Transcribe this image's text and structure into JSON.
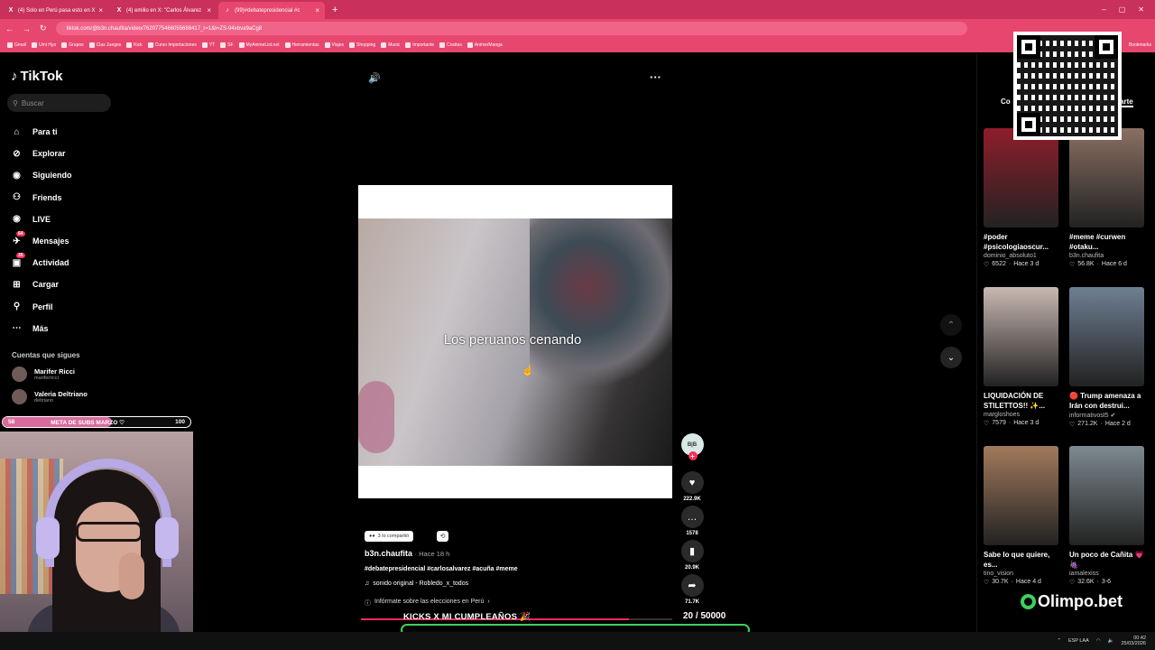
{
  "browser": {
    "tabs": [
      {
        "icon": "X",
        "title": "(4) Solo en Perú pasa esto en X"
      },
      {
        "icon": "X",
        "title": "(4) emilio en X: \"Carlos Álvarez"
      },
      {
        "icon": "♪",
        "title": "(99)#debatepresidencial #c"
      }
    ],
    "url": "tiktok.com/@b3n.chaufita/video/7620775466055688417_r=1&t=ZS-94xbva9aCg8",
    "bookmarks": [
      "Gmail",
      "Umi Hyo",
      "Grupos",
      "Clas Juegos",
      "Kick",
      "Curso Importaciones",
      "YT",
      "SF",
      "MyAnimeList.net",
      "Herramientas",
      "Viajes",
      "Shopping",
      "Music",
      "Importante",
      "Cositas",
      "Anime/Manga"
    ],
    "bookmarks_right": "Bookmarks"
  },
  "sidebar": {
    "logo": "TikTok",
    "search_placeholder": "Buscar",
    "nav": [
      {
        "label": "Para ti",
        "icon": "home-icon",
        "glyph": "⌂"
      },
      {
        "label": "Explorar",
        "icon": "compass-icon",
        "glyph": "⊘"
      },
      {
        "label": "Siguiendo",
        "icon": "following-icon",
        "glyph": "◉"
      },
      {
        "label": "Friends",
        "icon": "friends-icon",
        "glyph": "⚇"
      },
      {
        "label": "LIVE",
        "icon": "live-icon",
        "glyph": "◉"
      },
      {
        "label": "Mensajes",
        "icon": "messages-icon",
        "glyph": "✈",
        "badge": "64"
      },
      {
        "label": "Actividad",
        "icon": "activity-icon",
        "glyph": "▣",
        "badge": "35"
      },
      {
        "label": "Cargar",
        "icon": "upload-icon",
        "glyph": "⊞"
      },
      {
        "label": "Perfil",
        "icon": "profile-icon",
        "glyph": "⚲"
      },
      {
        "label": "Más",
        "icon": "more-icon",
        "glyph": "⋯"
      }
    ],
    "suggested_title": "Cuentas que sigues",
    "suggested": [
      {
        "name": "Marifer Ricci",
        "handle": "mariferricci"
      },
      {
        "name": "Valeria Deltriano",
        "handle": "deltriano"
      }
    ]
  },
  "goal_bar": {
    "left": "58",
    "label": "META DE SUBS MARZO ♡",
    "right": "100",
    "progress": 0.58
  },
  "video": {
    "caption": "Los peruanos cenando",
    "shared_label": "3 lo compartió",
    "author": "b3n.chaufita",
    "time": "· Hace 18 h",
    "tags": "#debatepresidencial #carlosalvarez #acuña #meme",
    "sound": "sonido original - Robledo_x_todos",
    "info": "Infórmate sobre las elecciones en Perú",
    "progress": 0.86
  },
  "actions": {
    "creator_initials": "B|B",
    "likes": "222.9K",
    "comments": "1578",
    "saves": "20.9K",
    "shares": "71.7K"
  },
  "kicks": {
    "title": "KICKS X MI CUMPLEAÑOS 🎉",
    "count": "20",
    "goal": "/ 50000"
  },
  "right_panel": {
    "tab_left": "Co",
    "tab_right": "arte",
    "cards": [
      {
        "title": "#poder #psicologiaoscur...",
        "user": "dominio_absoluto1",
        "views": "6522",
        "age": "Hace 3 d",
        "color": "#8e1e2a"
      },
      {
        "title": "#meme #curwen #otaku...",
        "user": "b3n.chaufita",
        "views": "56.8K",
        "age": "Hace 6 d",
        "color": "#8a6f63"
      },
      {
        "title": "LIQUIDACIÓN DE STILETTOS!! ✨...",
        "user": "margloshoes",
        "views": "7579",
        "age": "Hace 3 d",
        "color": "#c9b9b2"
      },
      {
        "title": "🔴 Trump amenaza a Irán con destrui...",
        "user": "informativost5 ✔",
        "views": "271.2K",
        "age": "Hace 2 d",
        "color": "#6f7f93"
      },
      {
        "title": "Sabe lo que quiere, es...",
        "user": "tino_vision",
        "views": "30.7K",
        "age": "Hace 4 d",
        "color": "#a27a5c"
      },
      {
        "title": "Un poco de Cañita 💗🍇",
        "user": "iamalexiss",
        "views": "32.6K",
        "age": "3-6",
        "color": "#7d8a8f"
      }
    ]
  },
  "overlay": {
    "sponsor": "Olimpo.bet"
  },
  "taskbar": {
    "lang": "ESP LAA",
    "time": "00:42",
    "date": "25/03/2026"
  }
}
